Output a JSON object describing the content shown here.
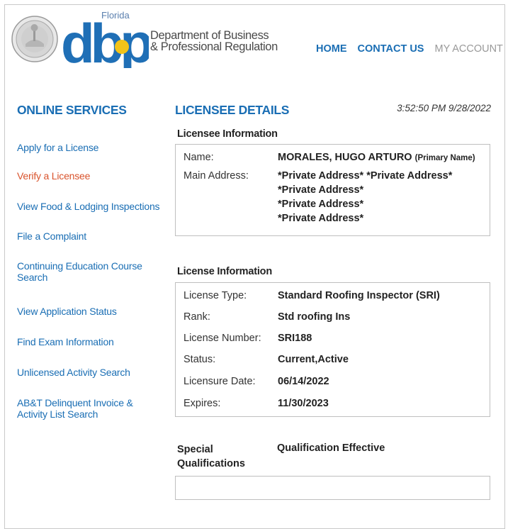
{
  "header": {
    "logo_text": "dbpr",
    "logo_state": "Florida",
    "department_line1": "Department of Business",
    "department_line2": "& Professional Regulation",
    "nav": {
      "home": "HOME",
      "contact": "CONTACT US",
      "account": "MY ACCOUNT"
    }
  },
  "sidebar": {
    "title": "ONLINE SERVICES",
    "items": [
      {
        "label": "Apply for a License"
      },
      {
        "label": "Verify a Licensee"
      },
      {
        "label": "View Food & Lodging Inspections"
      },
      {
        "label": "File a Complaint"
      },
      {
        "label": "Continuing Education Course Search"
      },
      {
        "label": "View Application Status"
      },
      {
        "label": "Find Exam Information"
      },
      {
        "label": "Unlicensed Activity Search"
      },
      {
        "label": "AB&T Delinquent Invoice & Activity List Search"
      }
    ]
  },
  "main": {
    "title": "LICENSEE DETAILS",
    "timestamp": "3:52:50 PM 9/28/2022",
    "licensee": {
      "section": "Licensee Information",
      "name_label": "Name:",
      "name_value": "MORALES, HUGO ARTURO",
      "name_note": "(Primary Name)",
      "address_label": "Main Address:",
      "address_line1": "*Private Address* *Private Address*",
      "address_line2": "*Private Address*",
      "address_line3": "*Private Address*",
      "address_line4": "*Private Address*"
    },
    "license": {
      "section": "License Information",
      "rows": [
        {
          "label": "License Type:",
          "value": "Standard Roofing Inspector (SRI)"
        },
        {
          "label": "Rank:",
          "value": "Std roofing Ins"
        },
        {
          "label": "License Number:",
          "value": "SRI188"
        },
        {
          "label": "Status:",
          "value": "Current,Active"
        },
        {
          "label": "Licensure Date:",
          "value": "06/14/2022"
        },
        {
          "label": "Expires:",
          "value": "11/30/2023"
        }
      ]
    },
    "qualifications": {
      "special_line1": "Special",
      "special_line2": "Qualifications",
      "effective": "Qualification Effective"
    }
  },
  "colors": {
    "link": "#1a6eb4",
    "active_link": "#d9532c",
    "logo_blue": "#1f6fb6",
    "logo_yellow": "#f2c318"
  }
}
